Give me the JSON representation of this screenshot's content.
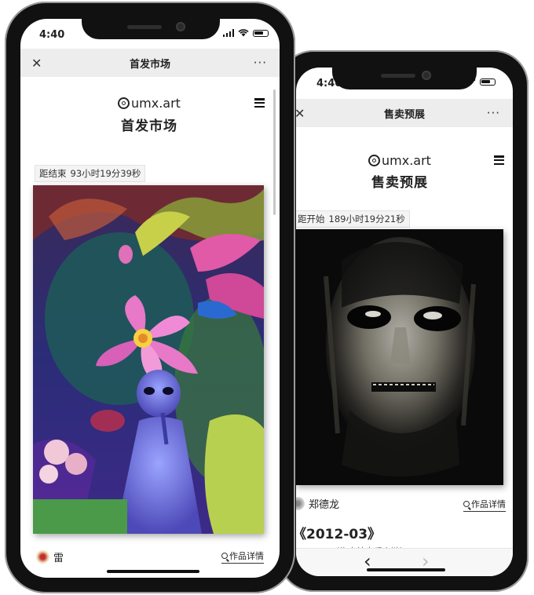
{
  "back_phone": {
    "status": {
      "time": "4:40"
    },
    "navbar": {
      "title": "售卖预展",
      "back_icon": "close-icon",
      "more_label": "···"
    },
    "brand": {
      "name": "umx.art",
      "logo_icon": "umx-logo-icon"
    },
    "page_title": "售卖预展",
    "menu_icon": "hamburger-menu-icon",
    "countdown": {
      "label": "距开始",
      "value": "189小时19分21秒"
    },
    "artwork": {
      "description": "dark abstract face painting"
    },
    "artist": {
      "name": "郑德龙"
    },
    "detail_link": "作品详情",
    "work_title": "《2012-03》",
    "work_subtitle": "（售卖结束后上链）",
    "bottom_nav": {
      "back": "‹",
      "forward": "›"
    }
  },
  "front_phone": {
    "status": {
      "time": "4:40"
    },
    "navbar": {
      "title": "首发市场",
      "close_label": "✕",
      "more_label": "···"
    },
    "brand": {
      "name": "umx.art",
      "logo_icon": "umx-logo-icon"
    },
    "page_title": "首发市场",
    "menu_icon": "hamburger-menu-icon",
    "countdown": {
      "label": "距结束",
      "value": "93小时19分39秒"
    },
    "artwork": {
      "description": "surreal painting of alien figure with flower"
    },
    "artist": {
      "name": "雷"
    },
    "detail_link": "作品详情"
  },
  "colors": {
    "navbar_bg": "#ededed",
    "frame": "#111111",
    "text": "#222222"
  }
}
